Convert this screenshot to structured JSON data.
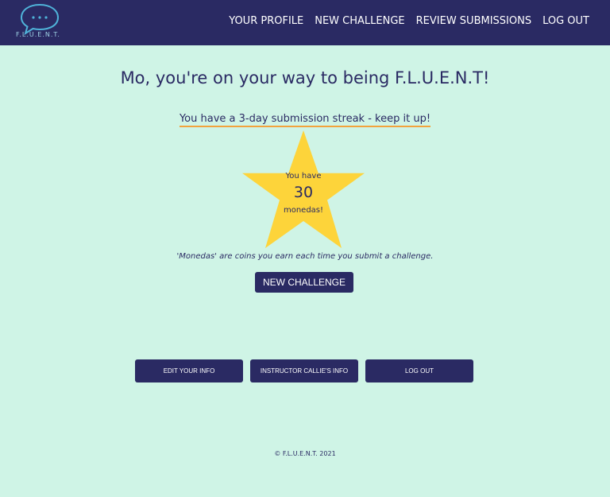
{
  "header": {
    "logo_text": "F.L.U.E.N.T.",
    "nav": [
      {
        "label": "YOUR PROFILE"
      },
      {
        "label": "NEW CHALLENGE"
      },
      {
        "label": "REVIEW SUBMISSIONS"
      },
      {
        "label": "LOG OUT"
      }
    ]
  },
  "main": {
    "greeting": "Mo, you're on your way to being F.L.U.E.N.T!",
    "streak_message": "You have a 3-day submission streak - keep it up!",
    "star": {
      "line1": "You have",
      "count": "30",
      "line3": "monedas!",
      "color": "#fdd43a"
    },
    "monedas_note": "'Monedas' are coins you earn each time you submit a challenge.",
    "new_challenge_button": "NEW CHALLENGE",
    "actions": {
      "edit_info": "EDIT YOUR INFO",
      "instructor_info": "INSTRUCTOR CALLIE'S INFO",
      "log_out": "LOG OUT"
    }
  },
  "footer": {
    "copyright": "© F.L.U.E.N.T. 2021"
  },
  "colors": {
    "navy": "#2a2a63",
    "background": "#cff4e6",
    "accent_underline": "#f2a23c",
    "logo_teal": "#4fb3d9"
  }
}
